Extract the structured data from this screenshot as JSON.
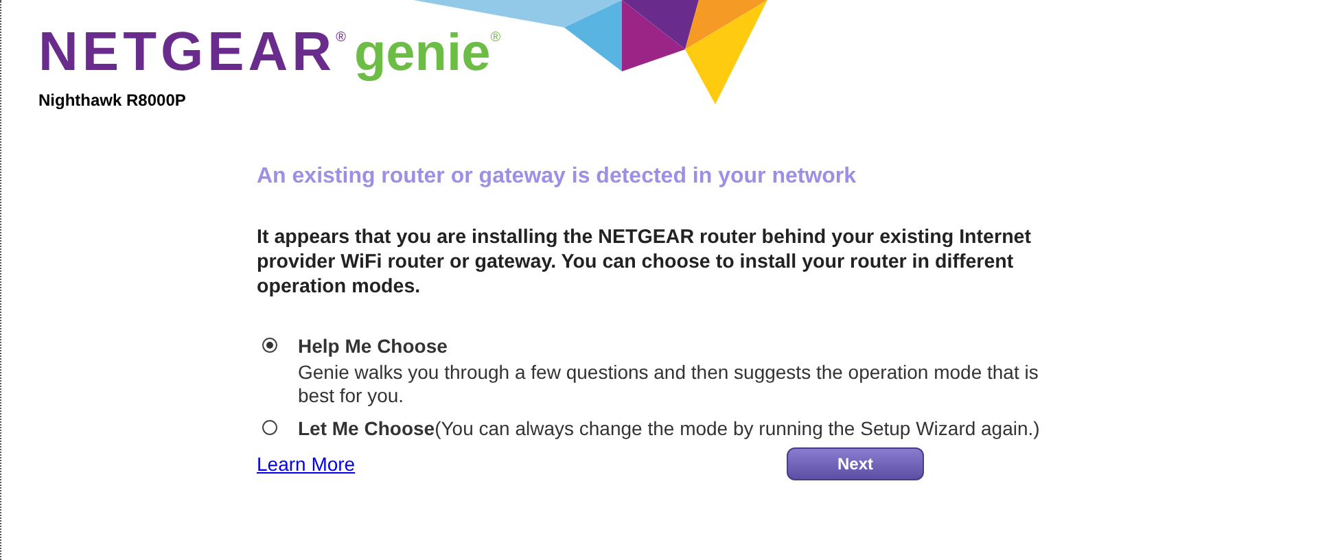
{
  "header": {
    "brand": "NETGEAR",
    "brand_mark": "®",
    "product": "genie",
    "product_mark": "®",
    "model": "Nighthawk R8000P"
  },
  "heading": "An existing router or gateway is detected in your network",
  "intro": "It appears that you are installing the NETGEAR router behind your existing Internet provider WiFi router or gateway. You can choose to install your router in different operation modes.",
  "options": [
    {
      "label": "Help Me Choose",
      "selected": true,
      "description": "Genie walks you through a few questions and then suggests the operation mode that is best for you."
    },
    {
      "label": "Let Me Choose",
      "selected": false,
      "note": "(You can always change the mode by running the Setup Wizard again.)"
    }
  ],
  "learn_more": "Learn More",
  "next_button": "Next"
}
